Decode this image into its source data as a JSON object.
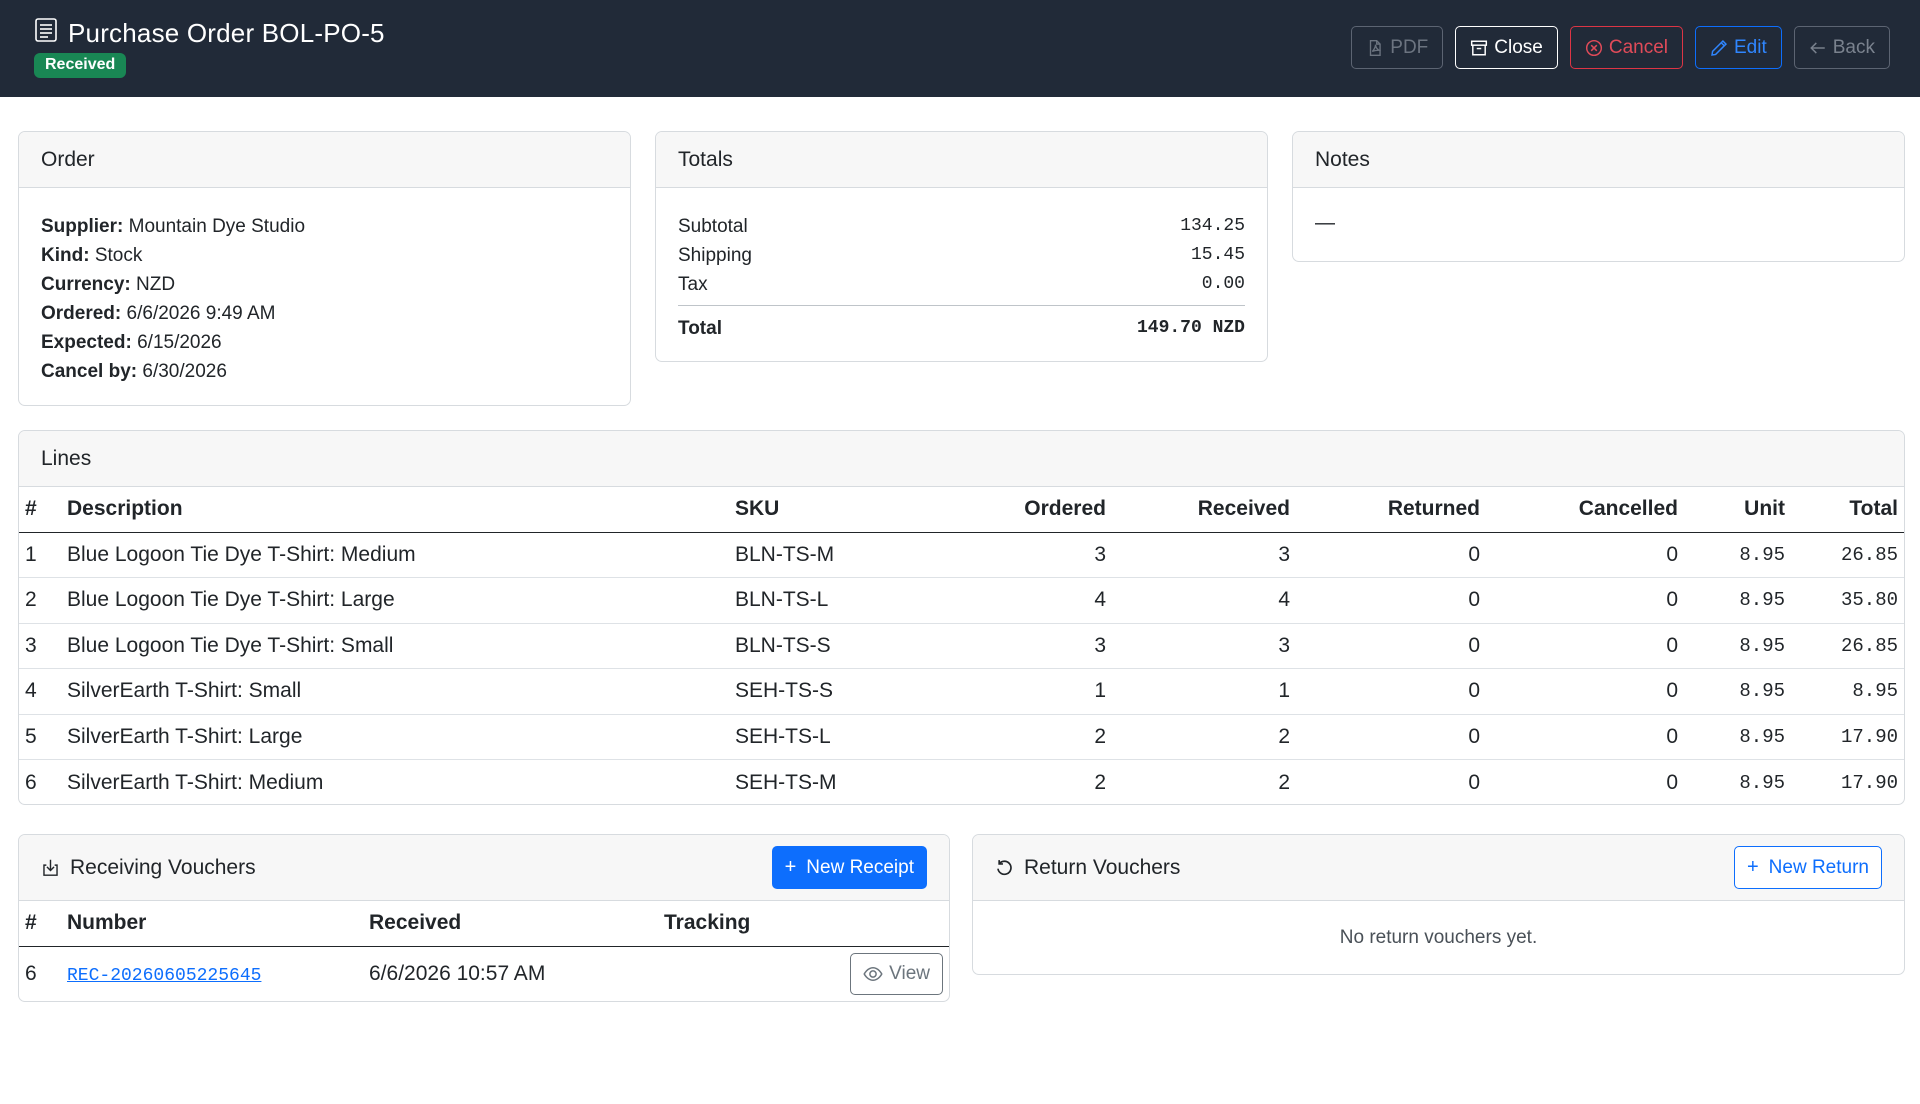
{
  "header": {
    "title": "Purchase Order BOL-PO-5",
    "status": "Received",
    "buttons": {
      "pdf": "PDF",
      "close": "Close",
      "cancel": "Cancel",
      "edit": "Edit",
      "back": "Back"
    }
  },
  "order": {
    "heading": "Order",
    "fields": [
      {
        "label": "Supplier:",
        "value": "Mountain Dye Studio"
      },
      {
        "label": "Kind:",
        "value": "Stock"
      },
      {
        "label": "Currency:",
        "value": "NZD"
      },
      {
        "label": "Ordered:",
        "value": "6/6/2026 9:49 AM"
      },
      {
        "label": "Expected:",
        "value": "6/15/2026"
      },
      {
        "label": "Cancel by:",
        "value": "6/30/2026"
      }
    ]
  },
  "totals": {
    "heading": "Totals",
    "subtotal_label": "Subtotal",
    "subtotal": "134.25",
    "shipping_label": "Shipping",
    "shipping": "15.45",
    "tax_label": "Tax",
    "tax": "0.00",
    "total_label": "Total",
    "total": "149.70 NZD"
  },
  "notes": {
    "heading": "Notes",
    "text": "—"
  },
  "lines": {
    "heading": "Lines",
    "columns": [
      "#",
      "Description",
      "SKU",
      "Ordered",
      "Received",
      "Returned",
      "Cancelled",
      "Unit",
      "Total"
    ],
    "rows": [
      [
        "1",
        "Blue Logoon Tie Dye T-Shirt: Medium",
        "BLN-TS-M",
        "3",
        "3",
        "0",
        "0",
        "8.95",
        "26.85"
      ],
      [
        "2",
        "Blue Logoon Tie Dye T-Shirt: Large",
        "BLN-TS-L",
        "4",
        "4",
        "0",
        "0",
        "8.95",
        "35.80"
      ],
      [
        "3",
        "Blue Logoon Tie Dye T-Shirt: Small",
        "BLN-TS-S",
        "3",
        "3",
        "0",
        "0",
        "8.95",
        "26.85"
      ],
      [
        "4",
        "SilverEarth T-Shirt: Small",
        "SEH-TS-S",
        "1",
        "1",
        "0",
        "0",
        "8.95",
        "8.95"
      ],
      [
        "5",
        "SilverEarth T-Shirt: Large",
        "SEH-TS-L",
        "2",
        "2",
        "0",
        "0",
        "8.95",
        "17.90"
      ],
      [
        "6",
        "SilverEarth T-Shirt: Medium",
        "SEH-TS-M",
        "2",
        "2",
        "0",
        "0",
        "8.95",
        "17.90"
      ]
    ]
  },
  "receiving": {
    "heading": "Receiving Vouchers",
    "new_button": "New Receipt",
    "columns": [
      "#",
      "Number",
      "Received",
      "Tracking"
    ],
    "rows": [
      {
        "id": "6",
        "number": "REC-20260605225645",
        "received": "6/6/2026 10:57 AM",
        "tracking": "",
        "action": "View"
      }
    ]
  },
  "returns": {
    "heading": "Return Vouchers",
    "new_button": "New Return",
    "empty": "No return vouchers yet."
  }
}
